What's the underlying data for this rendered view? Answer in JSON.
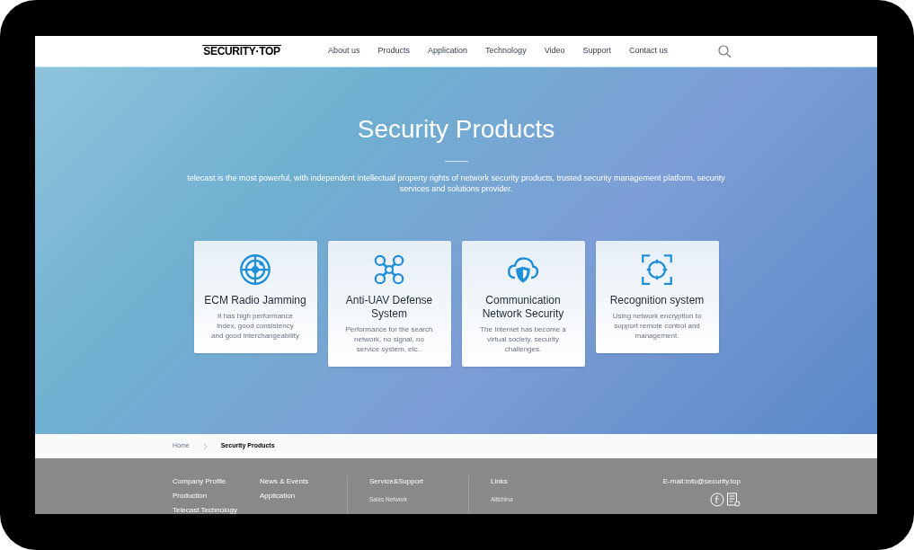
{
  "logo": {
    "text": "SECURITY·TOP"
  },
  "nav": [
    {
      "label": "About us"
    },
    {
      "label": "Products"
    },
    {
      "label": "Application"
    },
    {
      "label": "Technology"
    },
    {
      "label": "Video"
    },
    {
      "label": "Support"
    },
    {
      "label": "Contact us"
    }
  ],
  "hero": {
    "title": "Security Products",
    "description": "telecast is the most powerful, with independent intellectual property rights of network security products, trusted security management platform, security services and solutions provider."
  },
  "cards": [
    {
      "kind": "target",
      "title": "ECM Radio Jamming",
      "text": "It has high performance index, good consistency and good interchangeability"
    },
    {
      "kind": "drone",
      "title": "Anti-UAV Defense System",
      "text": "Performance for the search network, no signal, no service system, etc.."
    },
    {
      "kind": "cloud-shield",
      "title": "Communication Network Security",
      "text": "The Internet has become a virtual society, security challenges."
    },
    {
      "kind": "scan",
      "title": "Recognition system",
      "text": "Using network encryption to support remote control and management."
    }
  ],
  "breadcrumb": [
    {
      "label": "Home",
      "current": false
    },
    {
      "label": "Security Products",
      "current": true
    }
  ],
  "footer": {
    "columns": [
      {
        "links": [
          "Company Profile",
          "Production",
          "Telecast Technology"
        ]
      },
      {
        "links": [
          "News & Events",
          "Application"
        ]
      },
      {
        "heading": "Service&Support",
        "links": [
          "Sales Network"
        ]
      },
      {
        "heading": "Links",
        "links": [
          "Alitchina"
        ]
      }
    ],
    "email": "E-mail:info@security.top"
  }
}
